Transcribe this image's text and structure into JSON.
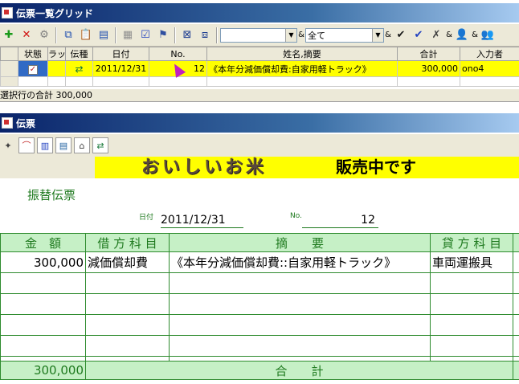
{
  "grid_window": {
    "title": "伝票一覧グリッド"
  },
  "toolbar": {
    "filter1_value": "",
    "filter2_value": "全て",
    "amp": "&"
  },
  "grid": {
    "headers": [
      "状態",
      "ラッ",
      "伝種",
      "日付",
      "No.",
      "姓名,摘要",
      "合計",
      "入力者"
    ],
    "rows": [
      {
        "date": "2011/12/31",
        "no": "12",
        "desc": "《本年分減価償却費:自家用軽トラック》",
        "total": "300,000",
        "user": "ono4"
      }
    ]
  },
  "status": {
    "text": "選択行の合計 300,000"
  },
  "voucher_window": {
    "title": "伝票"
  },
  "banner": {
    "logo": "おいしいお米",
    "text": "販売中です"
  },
  "voucher": {
    "title": "振替伝票",
    "date_label": "日付",
    "date": "2011/12/31",
    "no_label": "No.",
    "no": "12",
    "headers": [
      "金　額",
      "借 方 科 目",
      "摘　　要",
      "貸 方 科 目"
    ],
    "rows": [
      {
        "amount": "300,000",
        "debit": "減価償却費",
        "desc": "《本年分減価償却費::自家用軽トラック》",
        "credit": "車両運搬具"
      }
    ],
    "footer": {
      "amount": "300,000",
      "label": "合　　計"
    }
  }
}
